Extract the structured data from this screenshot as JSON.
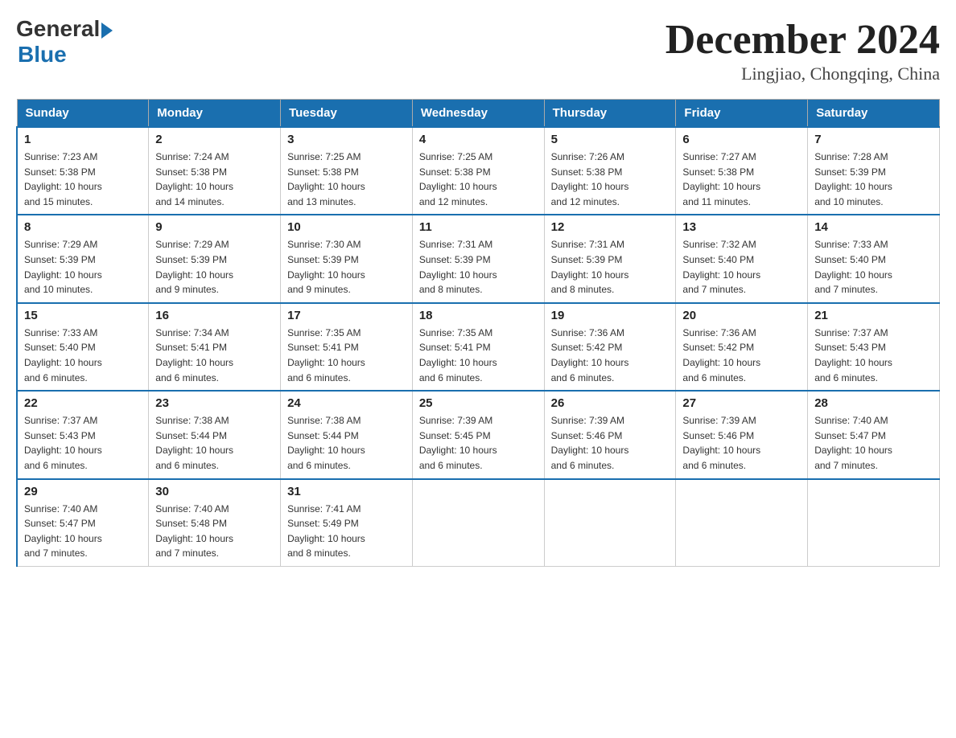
{
  "logo": {
    "general": "General",
    "blue": "Blue",
    "subtitle": "Blue"
  },
  "title": "December 2024",
  "location": "Lingjiao, Chongqing, China",
  "days_of_week": [
    "Sunday",
    "Monday",
    "Tuesday",
    "Wednesday",
    "Thursday",
    "Friday",
    "Saturday"
  ],
  "weeks": [
    [
      {
        "day": "1",
        "sunrise": "7:23 AM",
        "sunset": "5:38 PM",
        "daylight": "10 hours and 15 minutes."
      },
      {
        "day": "2",
        "sunrise": "7:24 AM",
        "sunset": "5:38 PM",
        "daylight": "10 hours and 14 minutes."
      },
      {
        "day": "3",
        "sunrise": "7:25 AM",
        "sunset": "5:38 PM",
        "daylight": "10 hours and 13 minutes."
      },
      {
        "day": "4",
        "sunrise": "7:25 AM",
        "sunset": "5:38 PM",
        "daylight": "10 hours and 12 minutes."
      },
      {
        "day": "5",
        "sunrise": "7:26 AM",
        "sunset": "5:38 PM",
        "daylight": "10 hours and 12 minutes."
      },
      {
        "day": "6",
        "sunrise": "7:27 AM",
        "sunset": "5:38 PM",
        "daylight": "10 hours and 11 minutes."
      },
      {
        "day": "7",
        "sunrise": "7:28 AM",
        "sunset": "5:39 PM",
        "daylight": "10 hours and 10 minutes."
      }
    ],
    [
      {
        "day": "8",
        "sunrise": "7:29 AM",
        "sunset": "5:39 PM",
        "daylight": "10 hours and 10 minutes."
      },
      {
        "day": "9",
        "sunrise": "7:29 AM",
        "sunset": "5:39 PM",
        "daylight": "10 hours and 9 minutes."
      },
      {
        "day": "10",
        "sunrise": "7:30 AM",
        "sunset": "5:39 PM",
        "daylight": "10 hours and 9 minutes."
      },
      {
        "day": "11",
        "sunrise": "7:31 AM",
        "sunset": "5:39 PM",
        "daylight": "10 hours and 8 minutes."
      },
      {
        "day": "12",
        "sunrise": "7:31 AM",
        "sunset": "5:39 PM",
        "daylight": "10 hours and 8 minutes."
      },
      {
        "day": "13",
        "sunrise": "7:32 AM",
        "sunset": "5:40 PM",
        "daylight": "10 hours and 7 minutes."
      },
      {
        "day": "14",
        "sunrise": "7:33 AM",
        "sunset": "5:40 PM",
        "daylight": "10 hours and 7 minutes."
      }
    ],
    [
      {
        "day": "15",
        "sunrise": "7:33 AM",
        "sunset": "5:40 PM",
        "daylight": "10 hours and 6 minutes."
      },
      {
        "day": "16",
        "sunrise": "7:34 AM",
        "sunset": "5:41 PM",
        "daylight": "10 hours and 6 minutes."
      },
      {
        "day": "17",
        "sunrise": "7:35 AM",
        "sunset": "5:41 PM",
        "daylight": "10 hours and 6 minutes."
      },
      {
        "day": "18",
        "sunrise": "7:35 AM",
        "sunset": "5:41 PM",
        "daylight": "10 hours and 6 minutes."
      },
      {
        "day": "19",
        "sunrise": "7:36 AM",
        "sunset": "5:42 PM",
        "daylight": "10 hours and 6 minutes."
      },
      {
        "day": "20",
        "sunrise": "7:36 AM",
        "sunset": "5:42 PM",
        "daylight": "10 hours and 6 minutes."
      },
      {
        "day": "21",
        "sunrise": "7:37 AM",
        "sunset": "5:43 PM",
        "daylight": "10 hours and 6 minutes."
      }
    ],
    [
      {
        "day": "22",
        "sunrise": "7:37 AM",
        "sunset": "5:43 PM",
        "daylight": "10 hours and 6 minutes."
      },
      {
        "day": "23",
        "sunrise": "7:38 AM",
        "sunset": "5:44 PM",
        "daylight": "10 hours and 6 minutes."
      },
      {
        "day": "24",
        "sunrise": "7:38 AM",
        "sunset": "5:44 PM",
        "daylight": "10 hours and 6 minutes."
      },
      {
        "day": "25",
        "sunrise": "7:39 AM",
        "sunset": "5:45 PM",
        "daylight": "10 hours and 6 minutes."
      },
      {
        "day": "26",
        "sunrise": "7:39 AM",
        "sunset": "5:46 PM",
        "daylight": "10 hours and 6 minutes."
      },
      {
        "day": "27",
        "sunrise": "7:39 AM",
        "sunset": "5:46 PM",
        "daylight": "10 hours and 6 minutes."
      },
      {
        "day": "28",
        "sunrise": "7:40 AM",
        "sunset": "5:47 PM",
        "daylight": "10 hours and 7 minutes."
      }
    ],
    [
      {
        "day": "29",
        "sunrise": "7:40 AM",
        "sunset": "5:47 PM",
        "daylight": "10 hours and 7 minutes."
      },
      {
        "day": "30",
        "sunrise": "7:40 AM",
        "sunset": "5:48 PM",
        "daylight": "10 hours and 7 minutes."
      },
      {
        "day": "31",
        "sunrise": "7:41 AM",
        "sunset": "5:49 PM",
        "daylight": "10 hours and 8 minutes."
      },
      null,
      null,
      null,
      null
    ]
  ],
  "labels": {
    "sunrise": "Sunrise:",
    "sunset": "Sunset:",
    "daylight": "Daylight:"
  }
}
